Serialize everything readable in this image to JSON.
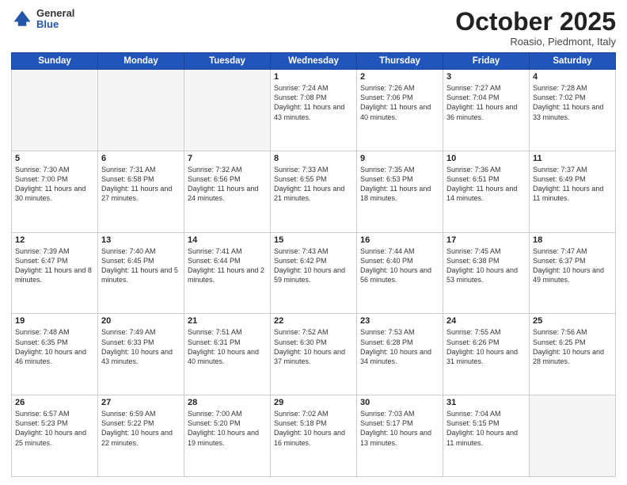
{
  "header": {
    "logo_general": "General",
    "logo_blue": "Blue",
    "month": "October 2025",
    "location": "Roasio, Piedmont, Italy"
  },
  "days_of_week": [
    "Sunday",
    "Monday",
    "Tuesday",
    "Wednesday",
    "Thursday",
    "Friday",
    "Saturday"
  ],
  "weeks": [
    [
      {
        "day": "",
        "info": ""
      },
      {
        "day": "",
        "info": ""
      },
      {
        "day": "",
        "info": ""
      },
      {
        "day": "1",
        "info": "Sunrise: 7:24 AM\nSunset: 7:08 PM\nDaylight: 11 hours\nand 43 minutes."
      },
      {
        "day": "2",
        "info": "Sunrise: 7:26 AM\nSunset: 7:06 PM\nDaylight: 11 hours\nand 40 minutes."
      },
      {
        "day": "3",
        "info": "Sunrise: 7:27 AM\nSunset: 7:04 PM\nDaylight: 11 hours\nand 36 minutes."
      },
      {
        "day": "4",
        "info": "Sunrise: 7:28 AM\nSunset: 7:02 PM\nDaylight: 11 hours\nand 33 minutes."
      }
    ],
    [
      {
        "day": "5",
        "info": "Sunrise: 7:30 AM\nSunset: 7:00 PM\nDaylight: 11 hours\nand 30 minutes."
      },
      {
        "day": "6",
        "info": "Sunrise: 7:31 AM\nSunset: 6:58 PM\nDaylight: 11 hours\nand 27 minutes."
      },
      {
        "day": "7",
        "info": "Sunrise: 7:32 AM\nSunset: 6:56 PM\nDaylight: 11 hours\nand 24 minutes."
      },
      {
        "day": "8",
        "info": "Sunrise: 7:33 AM\nSunset: 6:55 PM\nDaylight: 11 hours\nand 21 minutes."
      },
      {
        "day": "9",
        "info": "Sunrise: 7:35 AM\nSunset: 6:53 PM\nDaylight: 11 hours\nand 18 minutes."
      },
      {
        "day": "10",
        "info": "Sunrise: 7:36 AM\nSunset: 6:51 PM\nDaylight: 11 hours\nand 14 minutes."
      },
      {
        "day": "11",
        "info": "Sunrise: 7:37 AM\nSunset: 6:49 PM\nDaylight: 11 hours\nand 11 minutes."
      }
    ],
    [
      {
        "day": "12",
        "info": "Sunrise: 7:39 AM\nSunset: 6:47 PM\nDaylight: 11 hours\nand 8 minutes."
      },
      {
        "day": "13",
        "info": "Sunrise: 7:40 AM\nSunset: 6:45 PM\nDaylight: 11 hours\nand 5 minutes."
      },
      {
        "day": "14",
        "info": "Sunrise: 7:41 AM\nSunset: 6:44 PM\nDaylight: 11 hours\nand 2 minutes."
      },
      {
        "day": "15",
        "info": "Sunrise: 7:43 AM\nSunset: 6:42 PM\nDaylight: 10 hours\nand 59 minutes."
      },
      {
        "day": "16",
        "info": "Sunrise: 7:44 AM\nSunset: 6:40 PM\nDaylight: 10 hours\nand 56 minutes."
      },
      {
        "day": "17",
        "info": "Sunrise: 7:45 AM\nSunset: 6:38 PM\nDaylight: 10 hours\nand 53 minutes."
      },
      {
        "day": "18",
        "info": "Sunrise: 7:47 AM\nSunset: 6:37 PM\nDaylight: 10 hours\nand 49 minutes."
      }
    ],
    [
      {
        "day": "19",
        "info": "Sunrise: 7:48 AM\nSunset: 6:35 PM\nDaylight: 10 hours\nand 46 minutes."
      },
      {
        "day": "20",
        "info": "Sunrise: 7:49 AM\nSunset: 6:33 PM\nDaylight: 10 hours\nand 43 minutes."
      },
      {
        "day": "21",
        "info": "Sunrise: 7:51 AM\nSunset: 6:31 PM\nDaylight: 10 hours\nand 40 minutes."
      },
      {
        "day": "22",
        "info": "Sunrise: 7:52 AM\nSunset: 6:30 PM\nDaylight: 10 hours\nand 37 minutes."
      },
      {
        "day": "23",
        "info": "Sunrise: 7:53 AM\nSunset: 6:28 PM\nDaylight: 10 hours\nand 34 minutes."
      },
      {
        "day": "24",
        "info": "Sunrise: 7:55 AM\nSunset: 6:26 PM\nDaylight: 10 hours\nand 31 minutes."
      },
      {
        "day": "25",
        "info": "Sunrise: 7:56 AM\nSunset: 6:25 PM\nDaylight: 10 hours\nand 28 minutes."
      }
    ],
    [
      {
        "day": "26",
        "info": "Sunrise: 6:57 AM\nSunset: 5:23 PM\nDaylight: 10 hours\nand 25 minutes."
      },
      {
        "day": "27",
        "info": "Sunrise: 6:59 AM\nSunset: 5:22 PM\nDaylight: 10 hours\nand 22 minutes."
      },
      {
        "day": "28",
        "info": "Sunrise: 7:00 AM\nSunset: 5:20 PM\nDaylight: 10 hours\nand 19 minutes."
      },
      {
        "day": "29",
        "info": "Sunrise: 7:02 AM\nSunset: 5:18 PM\nDaylight: 10 hours\nand 16 minutes."
      },
      {
        "day": "30",
        "info": "Sunrise: 7:03 AM\nSunset: 5:17 PM\nDaylight: 10 hours\nand 13 minutes."
      },
      {
        "day": "31",
        "info": "Sunrise: 7:04 AM\nSunset: 5:15 PM\nDaylight: 10 hours\nand 11 minutes."
      },
      {
        "day": "",
        "info": ""
      }
    ]
  ]
}
